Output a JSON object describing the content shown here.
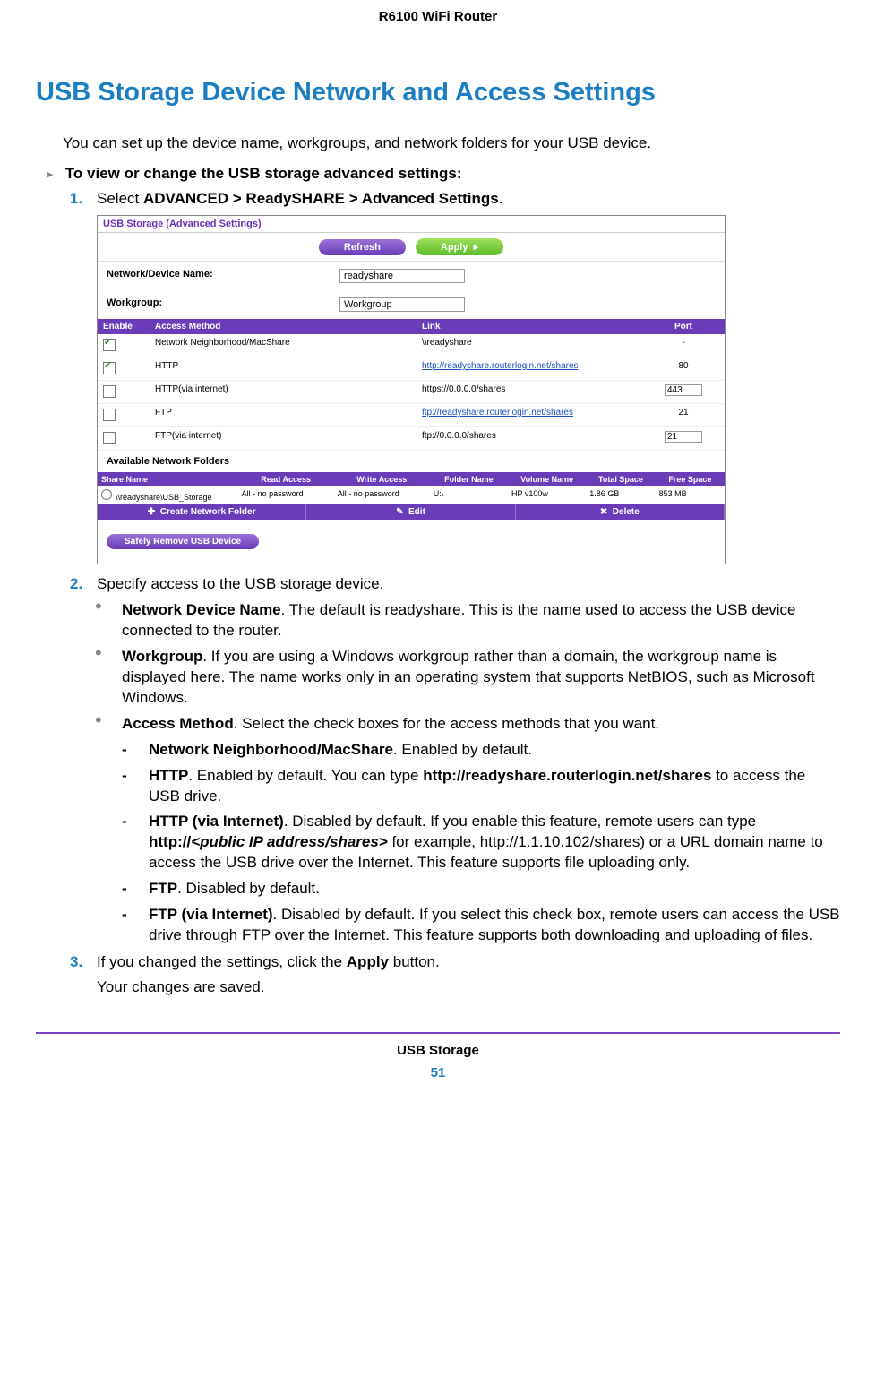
{
  "header": "R6100 WiFi Router",
  "title": "USB Storage Device Network and Access Settings",
  "intro": "You can set up the device name, workgroups, and network folders for your USB device.",
  "proc": "To view or change the USB storage advanced settings:",
  "step1": {
    "num": "1.",
    "a": "Select ",
    "b": "ADVANCED > ReadySHARE > Advanced Settings",
    "c": "."
  },
  "ss": {
    "title": "USB Storage (Advanced Settings)",
    "refresh": "Refresh",
    "apply": "Apply",
    "ndn_lbl": "Network/Device Name:",
    "ndn_val": "readyshare",
    "wg_lbl": "Workgroup:",
    "wg_val": "Workgroup",
    "th_en": "Enable",
    "th_am": "Access Method",
    "th_ln": "Link",
    "th_pt": "Port",
    "r": [
      {
        "c": true,
        "am": "Network Neighborhood/MacShare",
        "ln": "\\\\readyshare",
        "lk": false,
        "pt": "-",
        "pi": false
      },
      {
        "c": true,
        "am": "HTTP",
        "ln": "http://readyshare.routerlogin.net/shares",
        "lk": true,
        "pt": "80",
        "pi": false
      },
      {
        "c": false,
        "am": "HTTP(via internet)",
        "ln": "https://0.0.0.0/shares",
        "lk": false,
        "pt": "443",
        "pi": true
      },
      {
        "c": false,
        "am": "FTP",
        "ln": "ftp://readyshare.routerlogin.net/shares",
        "lk": true,
        "pt": "21",
        "pi": false
      },
      {
        "c": false,
        "am": "FTP(via internet)",
        "ln": "ftp://0.0.0.0/shares",
        "lk": false,
        "pt": "21",
        "pi": true
      }
    ],
    "anf": "Available Network Folders",
    "fh": {
      "sn": "Share Name",
      "ra": "Read Access",
      "wa": "Write Access",
      "fn": "Folder Name",
      "vn": "Volume Name",
      "ts": "Total Space",
      "fs": "Free Space"
    },
    "fr": {
      "sn": "\\\\readyshare\\USB_Storage",
      "ra": "All - no password",
      "wa": "All - no password",
      "fn": "U:\\",
      "vn": "HP v100w",
      "ts": "1.86 GB",
      "fs": "853 MB"
    },
    "act": {
      "cnf": "Create Network Folder",
      "ed": "Edit",
      "del": "Delete"
    },
    "safely": "Safely Remove USB Device"
  },
  "step2": {
    "num": "2.",
    "txt": "Specify access to the USB storage device."
  },
  "b1": {
    "t": "Network Device Name",
    "d": ". The default is readyshare. This is the name used to access the USB device connected to the router."
  },
  "b2": {
    "t": "Workgroup",
    "d": ". If you are using a Windows workgroup rather than a domain, the workgroup name is displayed here. The name works only in an operating system that supports NetBIOS, such as Microsoft Windows."
  },
  "b3": {
    "t": "Access Method",
    "d": ". Select the check boxes for the access methods that you want."
  },
  "d1": {
    "t": "Network Neighborhood/MacShare",
    "d": ". Enabled by default."
  },
  "d2": {
    "t": "HTTP",
    "d": ". Enabled by default. You can type ",
    "l": "http://readyshare.routerlogin.net/shares",
    "e": " to access the USB drive."
  },
  "d3": {
    "t": "HTTP (via Internet)",
    "d": ". Disabled by default. If you enable this feature, remote users can type ",
    "p1": "http://",
    "p2": "<public IP address/shares>",
    "p3": " for example, http://1.1.10.102/shares) or a URL domain name to access the USB drive over the Internet. This feature supports file uploading only."
  },
  "d4": {
    "t": "FTP",
    "d": ". Disabled by default."
  },
  "d5": {
    "t": "FTP (via Internet)",
    "d": ". Disabled by default. If you select this check box, remote users can access the USB drive through FTP over the Internet. This feature supports both downloading and uploading of files."
  },
  "step3": {
    "num": "3.",
    "a": "If you changed the settings, click the ",
    "b": "Apply",
    "c": " button."
  },
  "step3b": "Your changes are saved.",
  "footer": "USB Storage",
  "page": "51"
}
